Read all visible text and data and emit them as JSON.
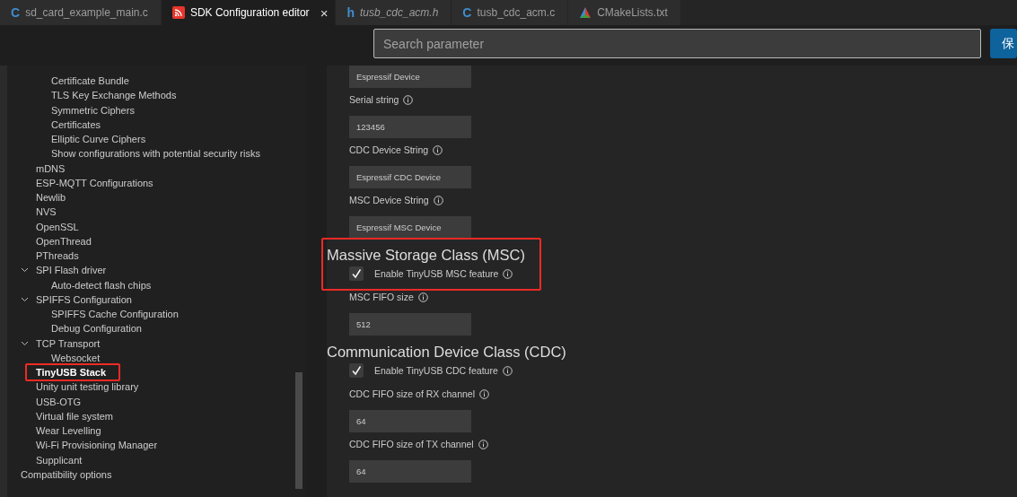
{
  "tabs": [
    {
      "label": "sd_card_example_main.c",
      "kind": "c",
      "glyph": "C",
      "preview": false,
      "selected": false
    },
    {
      "label": "SDK Configuration editor",
      "kind": "esp",
      "preview": false,
      "selected": true,
      "close": "×"
    },
    {
      "label": "tusb_cdc_acm.h",
      "kind": "h",
      "glyph": "h",
      "preview": true,
      "selected": false
    },
    {
      "label": "tusb_cdc_acm.c",
      "kind": "c",
      "glyph": "C",
      "preview": false,
      "selected": false
    },
    {
      "label": "CMakeLists.txt",
      "kind": "cmake",
      "preview": false,
      "selected": false
    }
  ],
  "search": {
    "placeholder": "Search parameter"
  },
  "save_button": {
    "label": "保"
  },
  "tree": [
    {
      "children": [
        {
          "children": [
            {
              "label": "Certificate Bundle",
              "selected": false,
              "highlighted": false
            },
            {
              "label": "TLS Key Exchange Methods",
              "selected": false,
              "highlighted": false
            },
            {
              "label": "Symmetric Ciphers",
              "selected": false,
              "highlighted": false
            },
            {
              "label": "Certificates",
              "selected": false,
              "highlighted": false
            },
            {
              "label": "Elliptic Curve Ciphers",
              "selected": false,
              "highlighted": false
            },
            {
              "label": "Show configurations with potential security risks",
              "selected": false,
              "highlighted": false
            }
          ]
        },
        {
          "label": "mDNS",
          "selected": false,
          "highlighted": false
        },
        {
          "label": "ESP-MQTT Configurations",
          "selected": false,
          "highlighted": false
        },
        {
          "label": "Newlib",
          "selected": false,
          "highlighted": false
        },
        {
          "label": "NVS",
          "selected": false,
          "highlighted": false
        },
        {
          "label": "OpenSSL",
          "selected": false,
          "highlighted": false
        },
        {
          "label": "OpenThread",
          "selected": false,
          "highlighted": false
        },
        {
          "label": "PThreads",
          "selected": false,
          "highlighted": false
        },
        {
          "label": "SPI Flash driver",
          "expanded": true,
          "selected": false,
          "highlighted": false,
          "children": [
            {
              "label": "Auto-detect flash chips",
              "selected": false,
              "highlighted": false
            }
          ]
        },
        {
          "label": "SPIFFS Configuration",
          "expanded": true,
          "selected": false,
          "highlighted": false,
          "children": [
            {
              "label": "SPIFFS Cache Configuration",
              "selected": false,
              "highlighted": false
            },
            {
              "label": "Debug Configuration",
              "selected": false,
              "highlighted": false
            }
          ]
        },
        {
          "label": "TCP Transport",
          "expanded": true,
          "selected": false,
          "highlighted": false,
          "children": [
            {
              "label": "Websocket",
              "selected": false,
              "highlighted": false
            }
          ]
        },
        {
          "label": "TinyUSB Stack",
          "selected": true,
          "highlighted": true
        },
        {
          "label": "Unity unit testing library",
          "selected": false,
          "highlighted": false
        },
        {
          "label": "USB-OTG",
          "selected": false,
          "highlighted": false
        },
        {
          "label": "Virtual file system",
          "selected": false,
          "highlighted": false
        },
        {
          "label": "Wear Levelling",
          "selected": false,
          "highlighted": false
        },
        {
          "label": "Wi-Fi Provisioning Manager",
          "selected": false,
          "highlighted": false
        },
        {
          "label": "Supplicant",
          "selected": false,
          "highlighted": false
        }
      ]
    },
    {
      "label": "Compatibility options",
      "selected": false,
      "highlighted": false
    }
  ],
  "settings": [
    {
      "kind": "field",
      "value": "Espressif Device"
    },
    {
      "kind": "text",
      "label": "Serial string",
      "value": "123456"
    },
    {
      "kind": "text",
      "label": "CDC Device String",
      "value": "Espressif CDC Device"
    },
    {
      "kind": "text",
      "label": "MSC Device String",
      "value": "Espressif MSC Device"
    },
    {
      "kind": "heading",
      "label": "Massive Storage Class (MSC)",
      "highlighted": true
    },
    {
      "kind": "checkbox",
      "label": "Enable TinyUSB MSC feature",
      "checked": true
    },
    {
      "kind": "text",
      "label": "MSC FIFO size",
      "value": "512"
    },
    {
      "kind": "heading",
      "label": "Communication Device Class (CDC)",
      "highlighted": false
    },
    {
      "kind": "checkbox",
      "label": "Enable TinyUSB CDC feature",
      "checked": true
    },
    {
      "kind": "text",
      "label": "CDC FIFO size of RX channel",
      "value": "64"
    },
    {
      "kind": "text",
      "label": "CDC FIFO size of TX channel",
      "value": "64"
    }
  ]
}
